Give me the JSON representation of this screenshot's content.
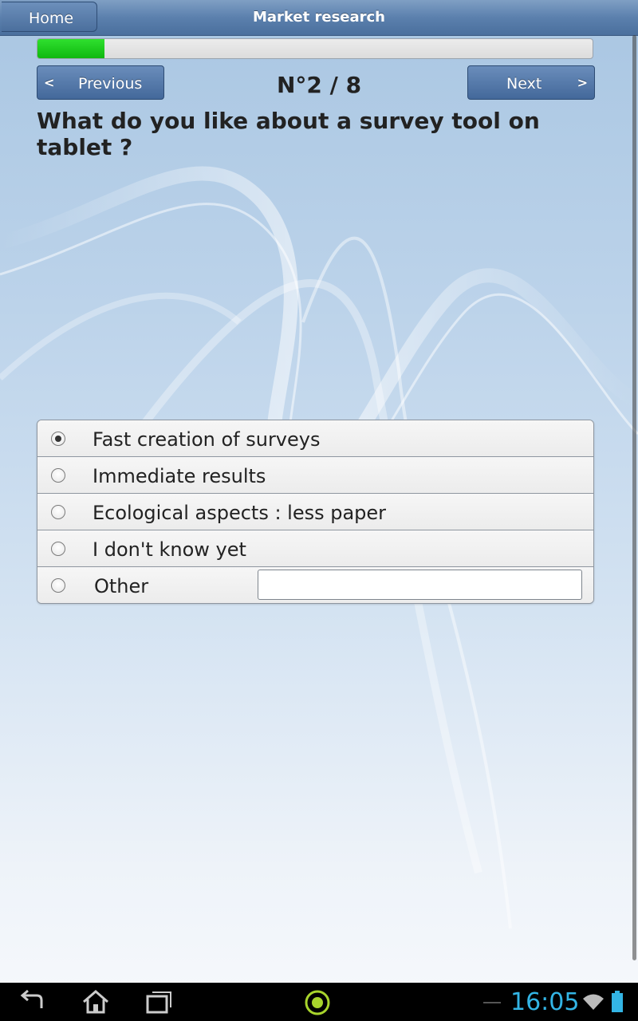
{
  "header": {
    "title": "Market research",
    "home_label": "Home"
  },
  "progress": {
    "fraction": 0.12,
    "fill_color": "#14c814"
  },
  "nav": {
    "previous_label": "Previous",
    "next_label": "Next",
    "counter": "N°2 / 8"
  },
  "question": "What do you like about a survey tool on tablet ?",
  "choices": [
    {
      "label": "Fast creation of surveys",
      "selected": true
    },
    {
      "label": "Immediate results",
      "selected": false
    },
    {
      "label": "Ecological aspects : less paper",
      "selected": false
    },
    {
      "label": "I don't know yet",
      "selected": false
    }
  ],
  "other": {
    "label": "Other",
    "value": "",
    "selected": false
  },
  "system_bar": {
    "time": "16:05",
    "icons": [
      "back-icon",
      "home-icon",
      "recent-apps-icon",
      "circle-app-icon",
      "wifi-icon",
      "battery-icon"
    ]
  }
}
